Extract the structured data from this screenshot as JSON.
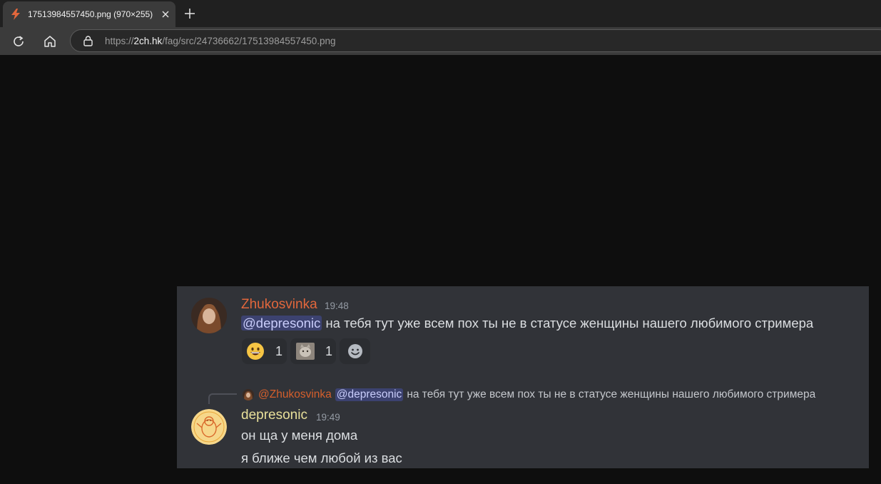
{
  "browser": {
    "tab": {
      "title": "17513984557450.png (970×255)",
      "favicon": "lightning-bolt-icon",
      "accent": "#e2673c"
    },
    "url": {
      "scheme": "https://",
      "host": "2ch.hk",
      "path": "/fag/src/24736662/17513984557450.png"
    }
  },
  "chat": {
    "background": "#313338",
    "messages": [
      {
        "author": "Zhukosvinka",
        "author_color": "#e2673c",
        "time": "19:48",
        "mention": "@depresonic",
        "text": "на тебя тут уже всем пох ты не в статусе женщины нашего любимого стримера",
        "reactions": [
          {
            "emoji": "grinning-face-emoji",
            "count": "1"
          },
          {
            "emoji": "cat-sticker-emoji",
            "count": "1"
          }
        ],
        "add_reaction_icon": "add-reaction-icon"
      },
      {
        "reply_to": {
          "author": "@Zhukosvinka",
          "mention": "@depresonic",
          "text": "на тебя тут уже всем пох ты не в статусе женщины нашего любимого стримера"
        },
        "author": "depresonic",
        "author_color": "#e8e09a",
        "time": "19:49",
        "lines": [
          "он ща у меня дома",
          "я ближе чем любой из вас"
        ]
      }
    ]
  }
}
